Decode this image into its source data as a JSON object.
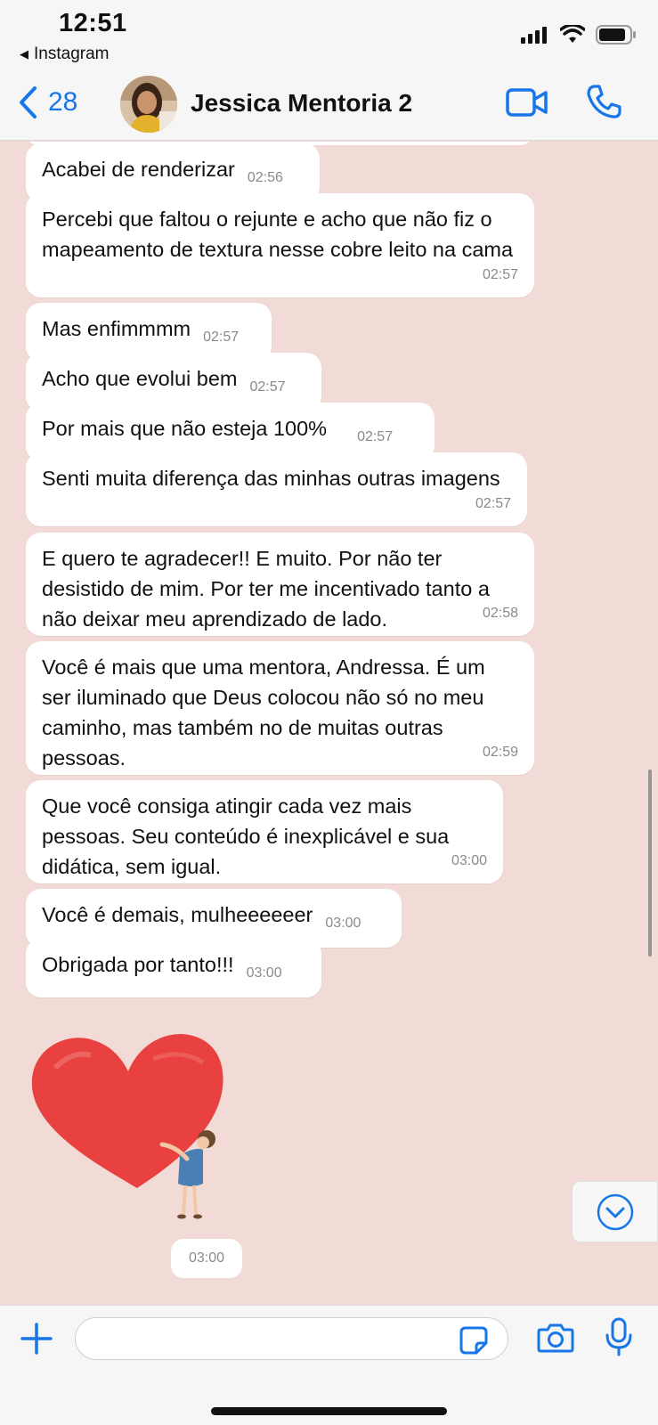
{
  "status_bar": {
    "time": "12:51",
    "back_app": "Instagram"
  },
  "header": {
    "back_count": "28",
    "contact_name": "Jessica Mentoria 2"
  },
  "messages": [
    {
      "text": "Acabei de renderizar",
      "time": "02:56"
    },
    {
      "text": "Percebi que faltou o rejunte e acho que não fiz o mapeamento de textura nesse cobre leito na cama",
      "time": "02:57"
    },
    {
      "text": "Mas enfimmmm",
      "time": "02:57"
    },
    {
      "text": "Acho que evolui bem",
      "time": "02:57"
    },
    {
      "text": "Por mais que não esteja 100%",
      "time": "02:57"
    },
    {
      "text": "Senti muita diferença das minhas outras imagens",
      "time": "02:57"
    },
    {
      "text": "E quero te agradecer!! E muito. Por não ter desistido de mim. Por ter me incentivado tanto a não deixar meu aprendizado de lado.",
      "time": "02:58"
    },
    {
      "text": "Você é mais que uma mentora, Andressa. É um ser iluminado que Deus colocou não só no meu caminho, mas também no de muitas outras pessoas.",
      "time": "02:59"
    },
    {
      "text": "Que você consiga atingir cada vez mais pessoas. Seu conteúdo é inexplicável e sua didática, sem igual.",
      "time": "03:00"
    },
    {
      "text": "Você é demais, mulheeeeeer",
      "time": "03:00"
    },
    {
      "text": "Obrigada por tanto!!!",
      "time": "03:00"
    }
  ],
  "sticker": {
    "icon": "heart-hug-sticker",
    "time": "03:00"
  },
  "composer": {
    "input_value": ""
  },
  "colors": {
    "accent": "#1777e8",
    "chat_bg": "#f2dbd6",
    "bubble": "#ffffff"
  }
}
